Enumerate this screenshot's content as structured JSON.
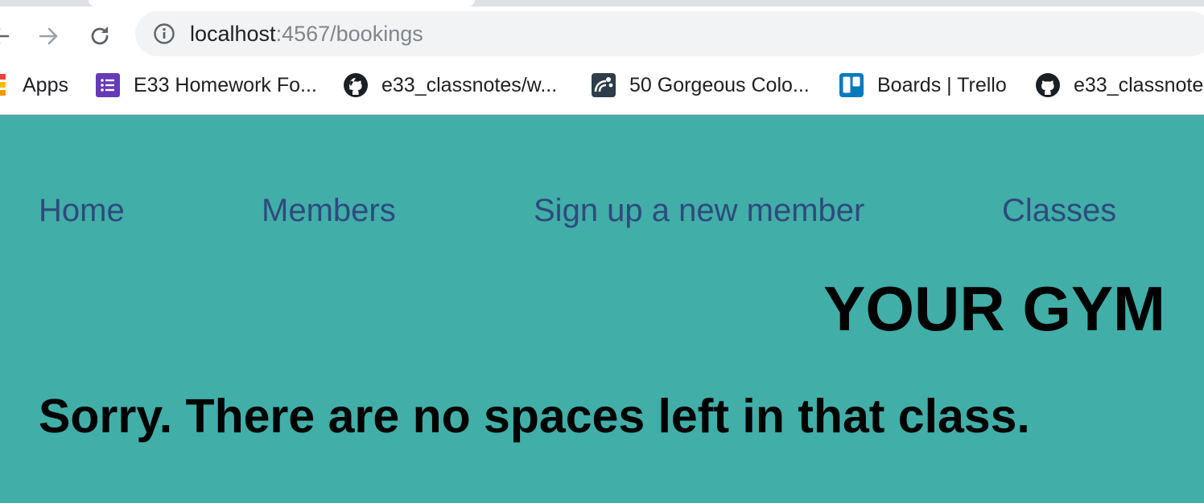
{
  "browser": {
    "url": {
      "host": "localhost",
      "path": ":4567/bookings"
    },
    "bookmarks": [
      {
        "label": "Apps",
        "icon": "apps-grid-icon"
      },
      {
        "label": "E33 Homework Fo...",
        "icon": "google-forms-icon"
      },
      {
        "label": "e33_classnotes/w...",
        "icon": "github-icon"
      },
      {
        "label": "50 Gorgeous Colo...",
        "icon": "palette-icon"
      },
      {
        "label": "Boards | Trello",
        "icon": "trello-icon"
      },
      {
        "label": "e33_classnote",
        "icon": "github-icon"
      }
    ]
  },
  "nav": {
    "home": "Home",
    "members": "Members",
    "signup": "Sign up a new member",
    "classes": "Classes"
  },
  "brand": "YOUR GYM",
  "message": "Sorry. There are no spaces left in that class.",
  "colors": {
    "page_background": "#41aea8",
    "nav_link": "#2f4a7d",
    "heading": "#000000"
  }
}
